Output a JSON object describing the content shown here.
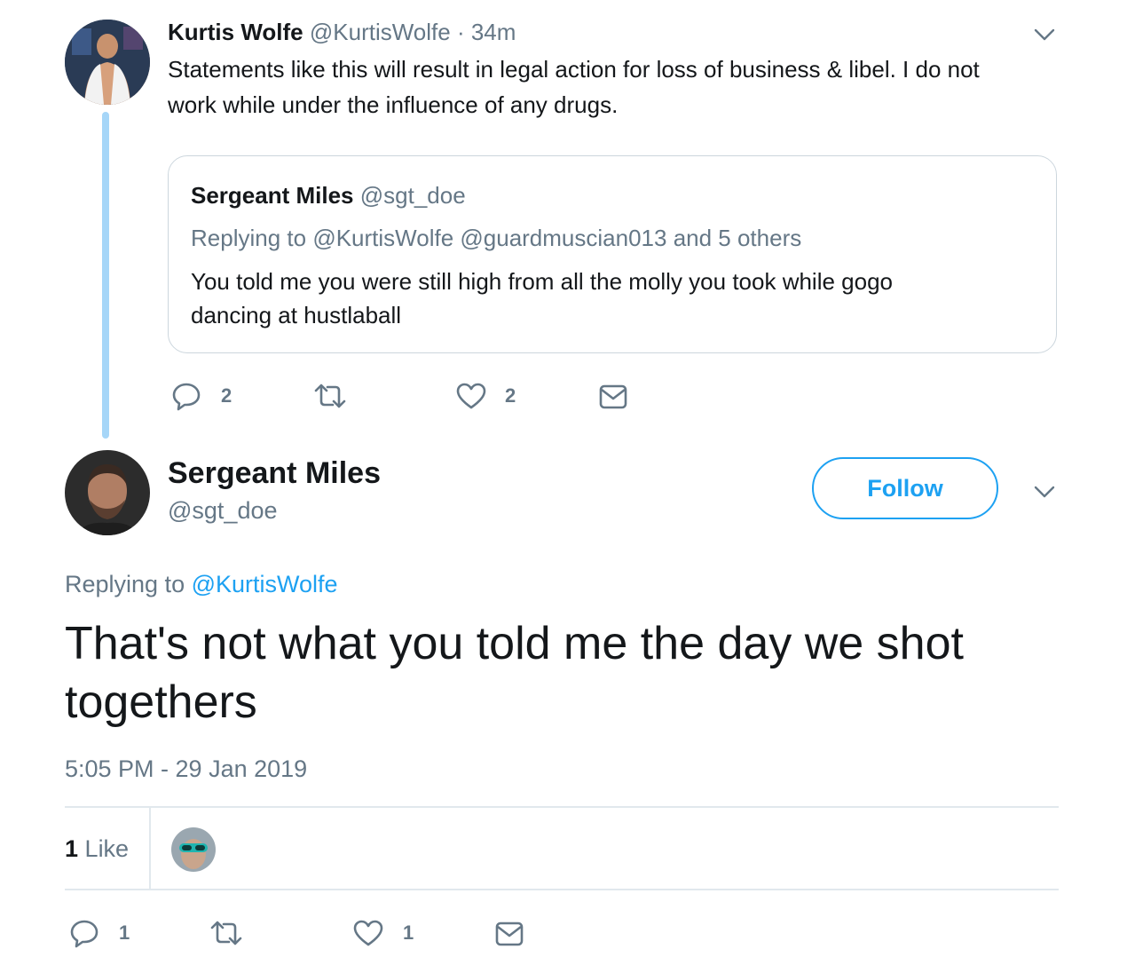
{
  "parent_tweet": {
    "author_name": "Kurtis Wolfe",
    "author_handle": "@KurtisWolfe",
    "time_ago": "· 34m",
    "text_line1": "Statements like this will result in legal action for loss of business & libel. I do not",
    "text_line2": "work while under the influence of any drugs.",
    "quoted": {
      "author_name": "Sergeant Miles",
      "author_handle": "@sgt_doe",
      "replying_prefix": "Replying to",
      "replying_targets": "@KurtisWolfe @guardmuscian013 and 5 others",
      "text_line1": "You told me you were still high from all the molly you took while gogo",
      "text_line2": "dancing at hustlaball"
    },
    "actions": {
      "reply_count": "2",
      "retweet_count": "",
      "like_count": "2"
    }
  },
  "main_tweet": {
    "author_name": "Sergeant Miles",
    "author_handle": "@sgt_doe",
    "follow_label": "Follow",
    "replying_prefix": "Replying to",
    "replying_to": "@KurtisWolfe",
    "text_line1": "That's not what you told me the day we shot",
    "text_line2": "togethers",
    "timestamp": "5:05 PM - 29 Jan 2019",
    "likes_count": "1",
    "likes_label": "Like",
    "actions": {
      "reply_count": "1",
      "retweet_count": "",
      "like_count": "1"
    }
  },
  "icons": [
    "chevron-down-icon",
    "reply-icon",
    "retweet-icon",
    "like-icon",
    "message-icon"
  ],
  "colors": {
    "accent": "#1da1f2",
    "secondary_text": "#657786",
    "thread_line": "#a6d6f8",
    "border": "#e1e8ed"
  }
}
